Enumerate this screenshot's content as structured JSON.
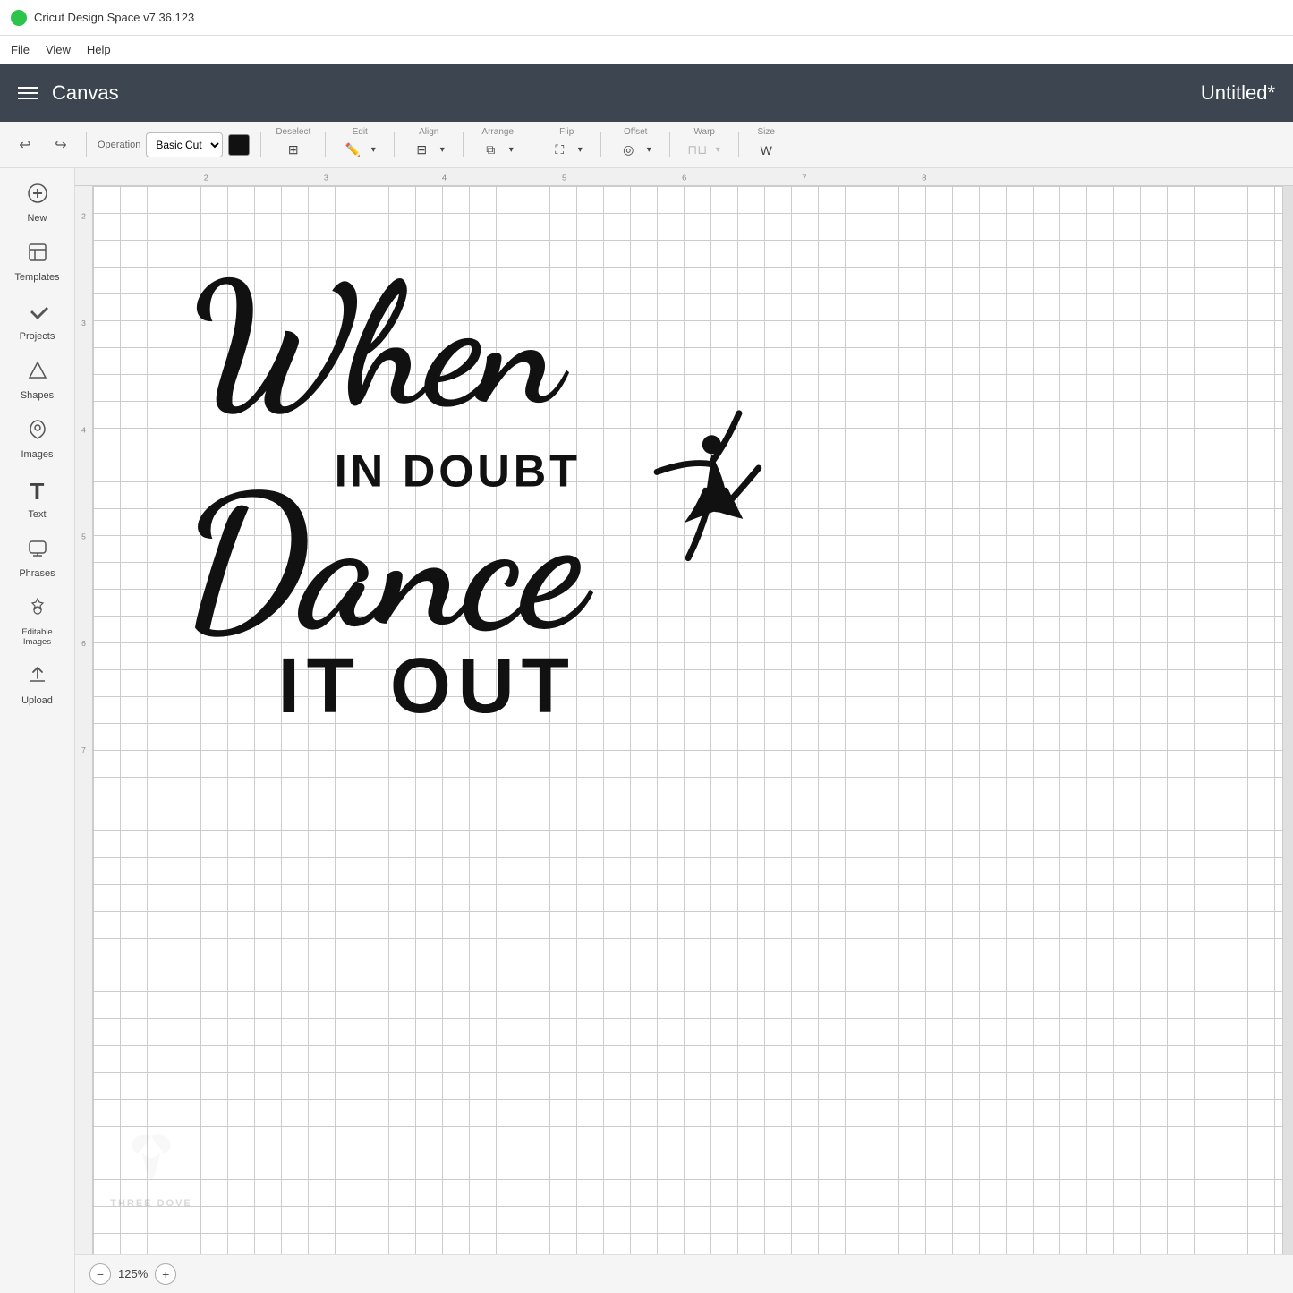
{
  "app": {
    "title": "Cricut Design Space  v7.36.123"
  },
  "menubar": {
    "file": "File",
    "view": "View",
    "help": "Help"
  },
  "header": {
    "canvas_label": "Canvas",
    "doc_title": "Untitled*",
    "menu_icon": "≡"
  },
  "toolbar": {
    "undo_label": "↩",
    "redo_label": "↪",
    "operation_label": "Operation",
    "operation_value": "Basic Cut",
    "deselect_label": "Deselect",
    "edit_label": "Edit",
    "align_label": "Align",
    "arrange_label": "Arrange",
    "flip_label": "Flip",
    "offset_label": "Offset",
    "warp_label": "Warp",
    "size_label": "Size"
  },
  "sidebar": {
    "items": [
      {
        "id": "new",
        "label": "New",
        "icon": "+"
      },
      {
        "id": "templates",
        "label": "Templates",
        "icon": "👕"
      },
      {
        "id": "projects",
        "label": "Projects",
        "icon": "♡"
      },
      {
        "id": "shapes",
        "label": "Shapes",
        "icon": "△"
      },
      {
        "id": "images",
        "label": "Images",
        "icon": "💡"
      },
      {
        "id": "text",
        "label": "Text",
        "icon": "T"
      },
      {
        "id": "phrases",
        "label": "Phrases",
        "icon": "💬"
      },
      {
        "id": "editable-images",
        "label": "Editable Images",
        "icon": "✦"
      },
      {
        "id": "upload",
        "label": "Upload",
        "icon": "↑"
      }
    ]
  },
  "canvas": {
    "design_text_line1": "When",
    "design_text_line2": "in doubt",
    "design_text_line3": "Dance",
    "design_text_line4": "IT OUT"
  },
  "bottom_bar": {
    "zoom_minus": "−",
    "zoom_level": "125%",
    "zoom_plus": "+"
  },
  "watermark": {
    "logo": "THREE DOVE"
  }
}
